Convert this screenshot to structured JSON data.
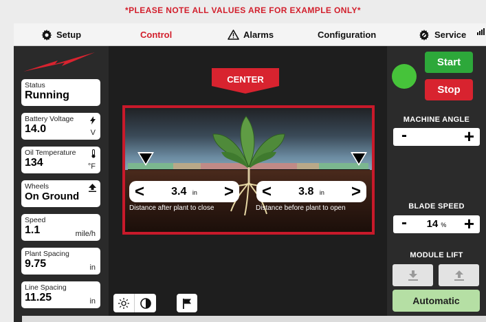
{
  "notice": "*PLEASE NOTE ALL VALUES ARE FOR EXAMPLE ONLY*",
  "menu": {
    "setup": "Setup",
    "control": "Control",
    "alarms": "Alarms",
    "configuration": "Configuration",
    "service": "Service"
  },
  "status_cards": [
    {
      "label": "Status",
      "value": "Running",
      "unit": ""
    },
    {
      "label": "Battery Voltage",
      "value": "14.0",
      "unit": "V"
    },
    {
      "label": "Oil Temperature",
      "value": "134",
      "unit": "°F"
    },
    {
      "label": "Wheels",
      "value": "On Ground",
      "unit": ""
    },
    {
      "label": "Speed",
      "value": "1.1",
      "unit": "mile/h"
    },
    {
      "label": "Plant Spacing",
      "value": "9.75",
      "unit": "in"
    },
    {
      "label": "Line Spacing",
      "value": "11.25",
      "unit": "in"
    }
  ],
  "view": {
    "center_label": "CENTER",
    "close": {
      "value": "3.4",
      "unit": "in",
      "label": "Distance after plant to close"
    },
    "open": {
      "value": "3.8",
      "unit": "in",
      "label": "Distance before plant to open"
    }
  },
  "controls": {
    "start": "Start",
    "stop": "Stop",
    "machine_angle_title": "MACHINE ANGLE",
    "blade_speed_title": "BLADE SPEED",
    "blade_speed_value": "14",
    "blade_speed_unit": "%",
    "module_lift_title": "MODULE LIFT",
    "automatic": "Automatic"
  },
  "colors": {
    "accent_red": "#d21e2b",
    "start_green": "#2da83a",
    "stop_red": "#d8232f",
    "indicator_green": "#46c33a",
    "automatic_green": "#b5dfa4"
  }
}
